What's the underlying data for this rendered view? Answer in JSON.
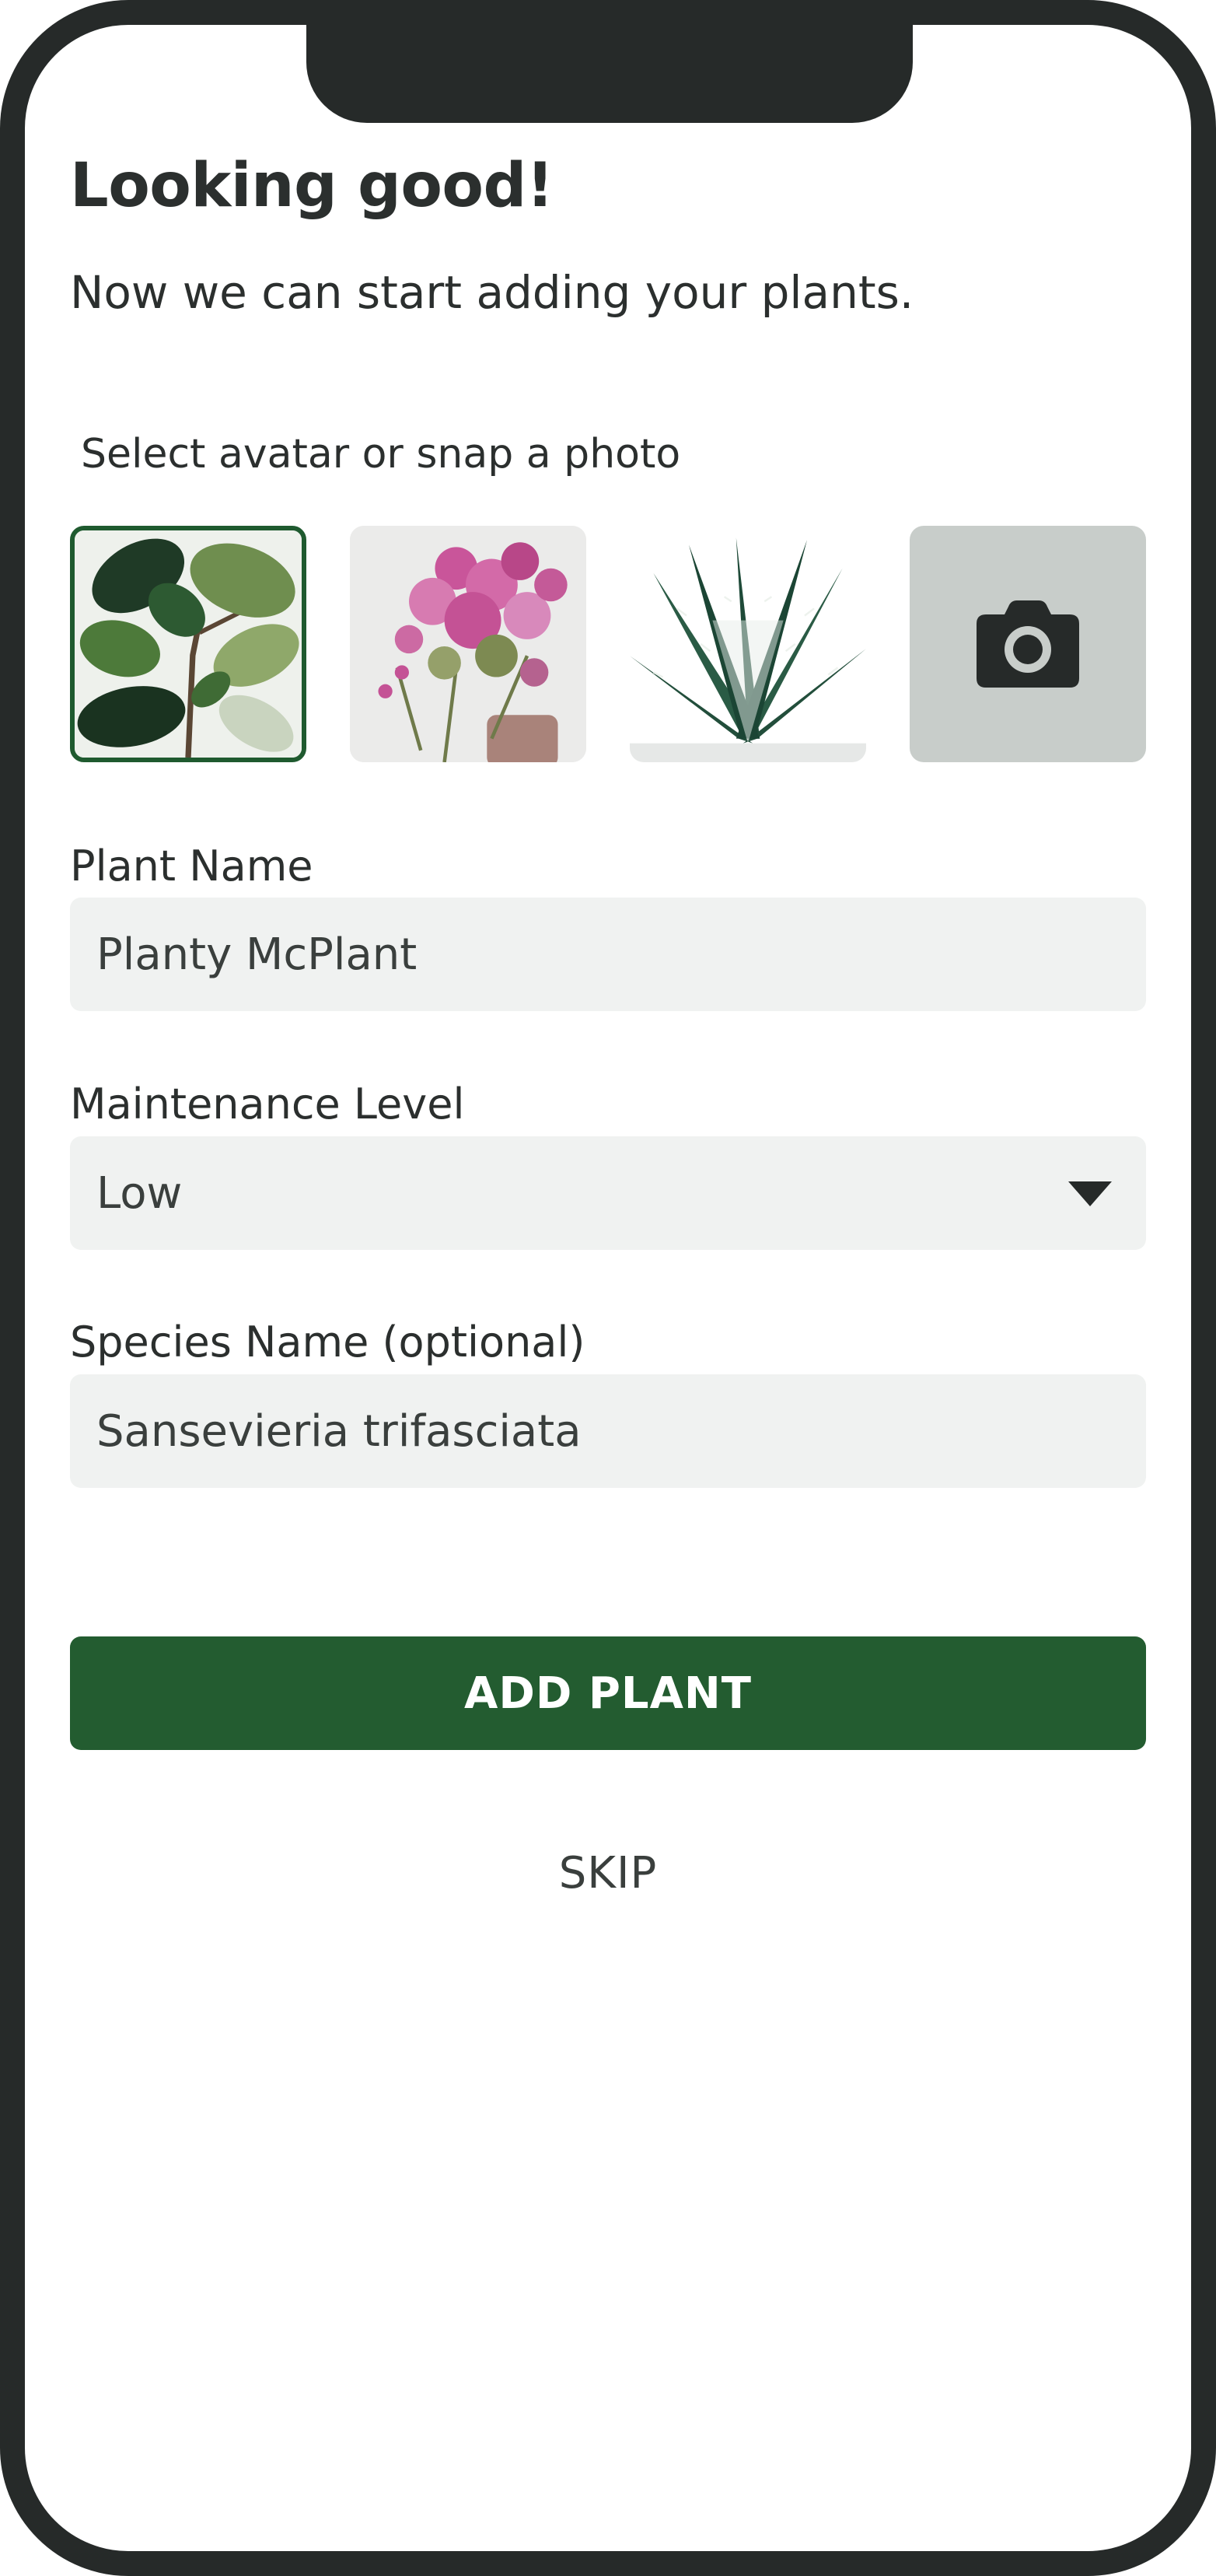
{
  "header": {
    "title": "Looking good!",
    "subtitle": "Now we can start adding your plants."
  },
  "avatar_picker": {
    "label": "Select avatar or snap a photo",
    "options": [
      {
        "name": "fiddle-leaf-fig",
        "selected": true
      },
      {
        "name": "pink-flowering-plant",
        "selected": false
      },
      {
        "name": "zebra-haworthia",
        "selected": false
      },
      {
        "name": "camera-icon",
        "selected": false
      }
    ]
  },
  "form": {
    "plant_name": {
      "label": "Plant Name",
      "value": "Planty McPlant"
    },
    "maintenance": {
      "label": "Maintenance Level",
      "value": "Low"
    },
    "species": {
      "label": "Species Name (optional)",
      "value": "Sansevieria trifasciata"
    }
  },
  "actions": {
    "add_label": "ADD PLANT",
    "skip_label": "SKIP"
  },
  "colors": {
    "primary": "#235c30",
    "frame": "#262a29",
    "field_bg": "#f0f2f1",
    "text": "#2b2f2e"
  }
}
